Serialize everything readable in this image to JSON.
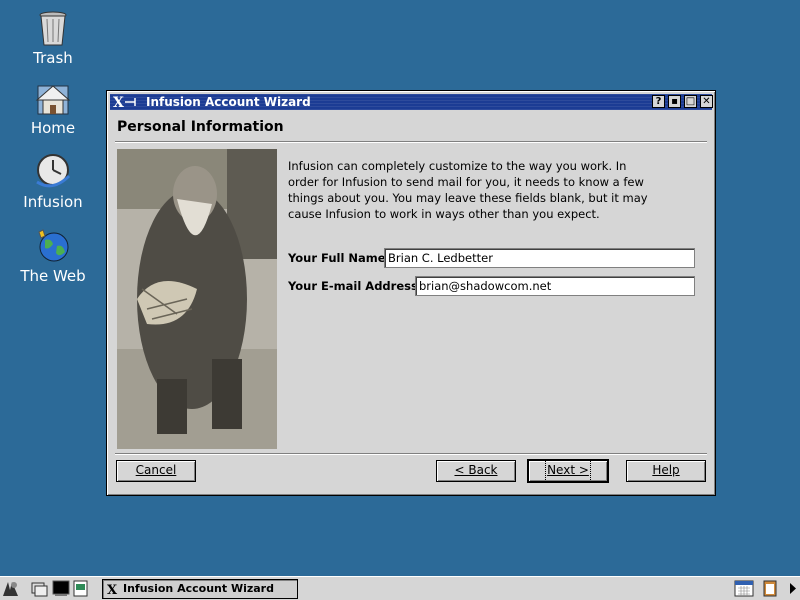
{
  "desktop": {
    "background": "#2c6a98",
    "icons": [
      {
        "label": "Trash",
        "icon": "trash-icon"
      },
      {
        "label": "Home",
        "icon": "home-icon"
      },
      {
        "label": "Infusion",
        "icon": "infusion-icon"
      },
      {
        "label": "The Web",
        "icon": "globe-icon"
      }
    ]
  },
  "window": {
    "title": "Infusion Account Wizard",
    "title_buttons": [
      "?",
      "▪",
      "□",
      "✕"
    ],
    "section_title": "Personal Information",
    "description": "Infusion can completely customize to the way you work.  In order for Infusion to send mail for you, it needs to know a few things about you.  You may leave these fields blank, but it may cause Infusion to work in ways other than you expect.",
    "fields": {
      "full_name": {
        "label": "Your Full Name",
        "value": "Brian C. Ledbetter"
      },
      "email": {
        "label": "Your E-mail Address",
        "value": "brian@shadowcom.net"
      }
    },
    "buttons": {
      "cancel": "Cancel",
      "back": "< Back",
      "next": "Next >",
      "help": "Help"
    }
  },
  "taskbar": {
    "task_label": "Infusion Account Wizard"
  }
}
